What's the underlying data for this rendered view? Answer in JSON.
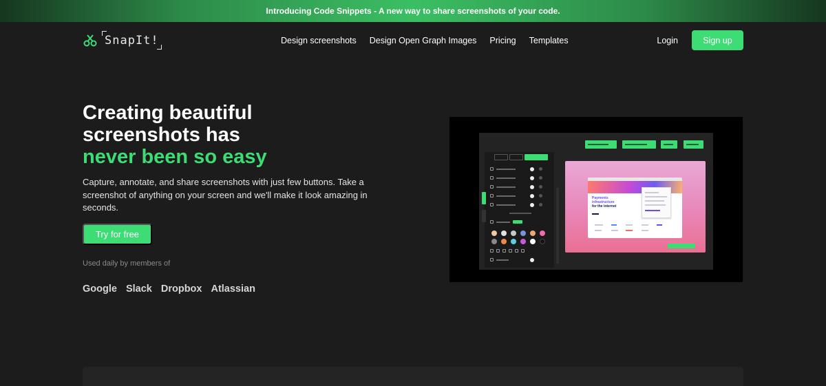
{
  "announcement": {
    "text": "Introducing Code Snippets - A new way to share screenshots of your code."
  },
  "nav": {
    "logo_text": "SnapIt!",
    "links": [
      "Design screenshots",
      "Design Open Graph Images",
      "Pricing",
      "Templates"
    ],
    "login_label": "Login",
    "signup_label": "Sign up"
  },
  "hero": {
    "title_line1": "Creating beautiful",
    "title_line2": "screenshots has",
    "title_accent": "never been so easy",
    "description": "Capture, annotate, and share screenshots with just few buttons. Take a screenshot of anything on your screen and we'll make it look amazing in seconds.",
    "cta_label": "Try for free",
    "used_by_label": "Used daily by members of",
    "brands": [
      "Google",
      "Slack",
      "Dropbox",
      "Atlassian"
    ]
  },
  "preview": {
    "mock_headline_1": "Payments",
    "mock_headline_2": "infrastructure",
    "mock_headline_3": "for the internet"
  },
  "colors": {
    "background": "#1c1c1c",
    "accent": "#3ddc74",
    "announce_green": "#3bbf63"
  },
  "icons": {
    "logo": "scissors-logo-icon"
  }
}
